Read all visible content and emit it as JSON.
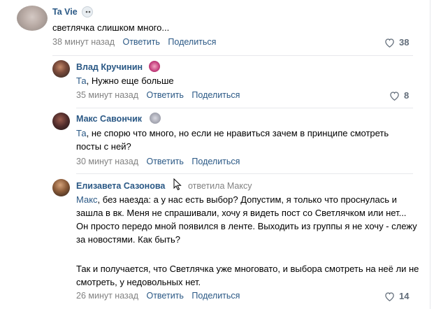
{
  "comments": [
    {
      "author": "Ta Vie",
      "text_reply": "",
      "text": "светлячка слишком много...",
      "time": "38 минут назад",
      "reply_label": "Ответить",
      "share_label": "Поделиться",
      "likes": "38"
    },
    {
      "author": "Влад Кручинин",
      "text_reply": "Та",
      "text": ", Нужно еще больше",
      "time": "35 минут назад",
      "reply_label": "Ответить",
      "share_label": "Поделиться",
      "likes": "8"
    },
    {
      "author": "Макс Савончик",
      "text_reply": "Та",
      "text": ", не спорю что много, но если не нравиться зачем в принципе смотреть посты с ней?",
      "time": "30 минут назад",
      "reply_label": "Ответить",
      "share_label": "Поделиться",
      "likes": ""
    },
    {
      "author": "Елизавета Сазонова",
      "answered": "ответила Максу",
      "text_reply": "Макс",
      "text": ", без наезда: а у нас есть выбор? Допустим, я только что проснулась и зашла в вк. Меня не спрашивали, хочу я видеть пост со Светлячком или нет... Он просто передо мной появился в ленте. Выходить из группы я не хочу - слежу за новостями. Как быть?",
      "text2": "Так и получается, что Светлячка уже многовато, и выбора смотреть на неё ли не смотреть, у недовольных нет.",
      "time": "26 минут назад",
      "reply_label": "Ответить",
      "share_label": "Поделиться",
      "likes": "14"
    }
  ],
  "icons": {
    "heart": "heart-icon",
    "cursor": "mouse-cursor-icon"
  },
  "colors": {
    "link": "#2a5885",
    "meta": "#828282",
    "divider": "#e7e8ec"
  }
}
